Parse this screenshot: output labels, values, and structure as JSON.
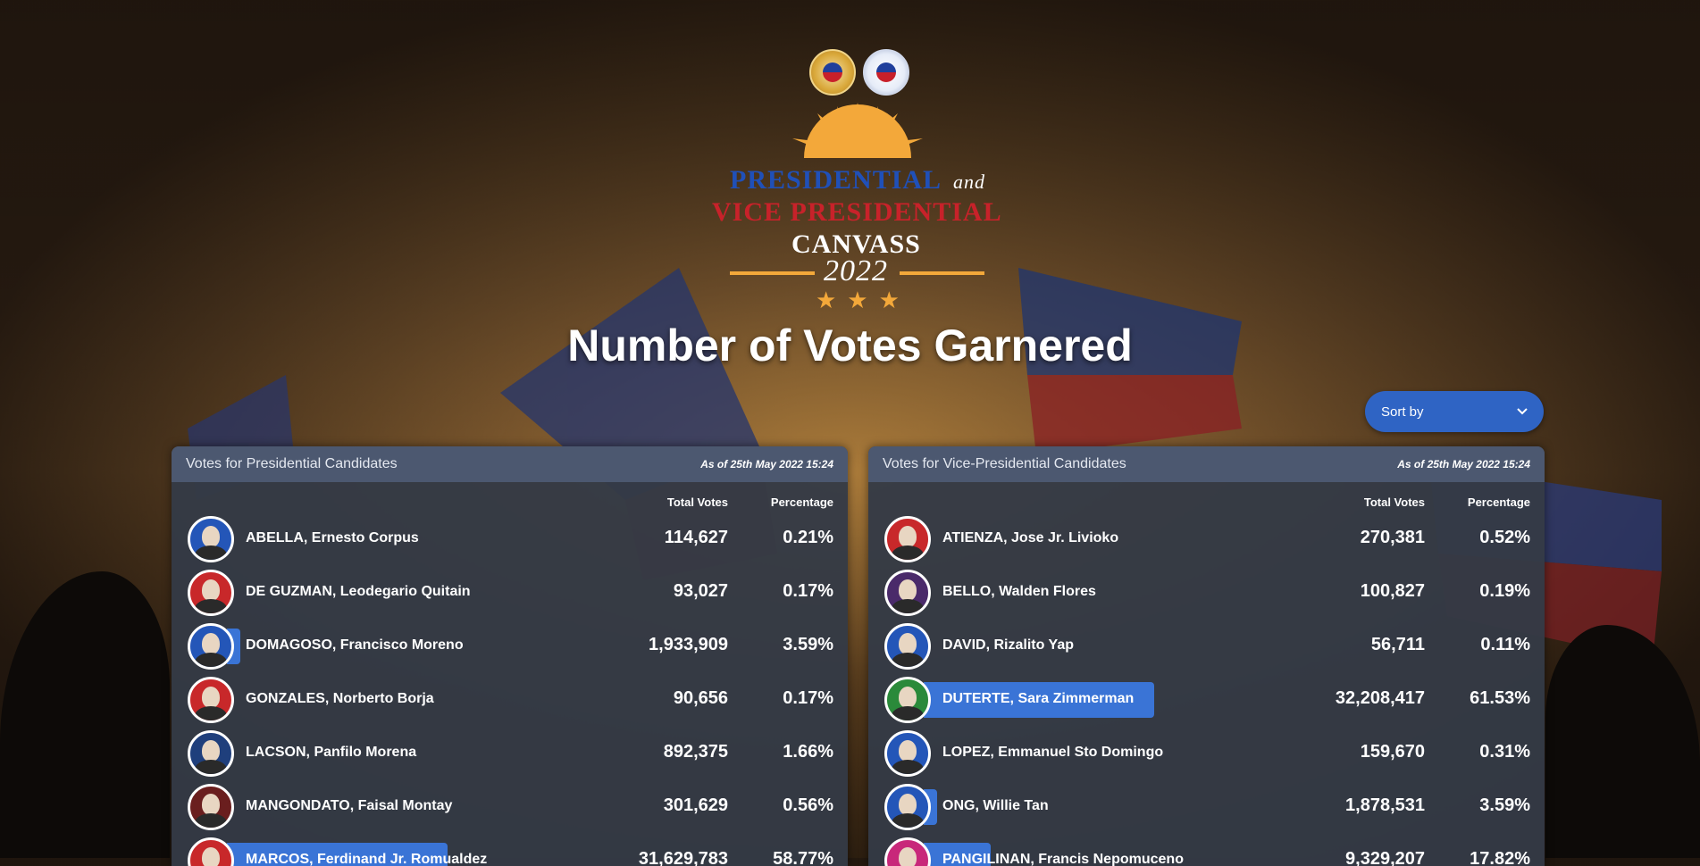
{
  "logo": {
    "word_presidential": "PRESIDENTIAL",
    "word_and": "and",
    "word_vice": "VICE PRESIDENTIAL",
    "word_canvass": "CANVASS",
    "year": "2022"
  },
  "title": "Number of Votes Garnered",
  "sort": {
    "label": "Sort by"
  },
  "colors": {
    "accent": "#3a74d6",
    "panel": "#343a46",
    "panel_head": "#4c5870",
    "sort_bg": "#2f64c4"
  },
  "presidential": {
    "header": "Votes for Presidential Candidates",
    "as_of": "As of 25th May 2022 15:24",
    "col_total": "Total Votes",
    "col_pct": "Percentage",
    "rows": [
      {
        "name": "ABELLA, Ernesto Corpus",
        "votes": "114,627",
        "pct": "0.21%",
        "ring": "#2456b8",
        "bar": 0
      },
      {
        "name": "DE GUZMAN, Leodegario Quitain",
        "votes": "93,027",
        "pct": "0.17%",
        "ring": "#c8282a",
        "bar": 0
      },
      {
        "name": "DOMAGOSO, Francisco Moreno",
        "votes": "1,933,909",
        "pct": "3.59%",
        "ring": "#2456b8",
        "bar": 3.59
      },
      {
        "name": "GONZALES, Norberto Borja",
        "votes": "90,656",
        "pct": "0.17%",
        "ring": "#c8282a",
        "bar": 0
      },
      {
        "name": "LACSON, Panfilo Morena",
        "votes": "892,375",
        "pct": "1.66%",
        "ring": "#1f3f7c",
        "bar": 0
      },
      {
        "name": "MANGONDATO, Faisal Montay",
        "votes": "301,629",
        "pct": "0.56%",
        "ring": "#6a1e1e",
        "bar": 0
      },
      {
        "name": "MARCOS, Ferdinand Jr. Romualdez",
        "votes": "31,629,783",
        "pct": "58.77%",
        "ring": "#c8282a",
        "bar": 58.77
      }
    ]
  },
  "vice": {
    "header": "Votes for Vice-Presidential Candidates",
    "as_of": "As of 25th May 2022 15:24",
    "col_total": "Total Votes",
    "col_pct": "Percentage",
    "rows": [
      {
        "name": "ATIENZA, Jose Jr. Livioko",
        "votes": "270,381",
        "pct": "0.52%",
        "ring": "#c8282a",
        "bar": 0
      },
      {
        "name": "BELLO, Walden Flores",
        "votes": "100,827",
        "pct": "0.19%",
        "ring": "#4a2a6a",
        "bar": 0
      },
      {
        "name": "DAVID, Rizalito Yap",
        "votes": "56,711",
        "pct": "0.11%",
        "ring": "#2456b8",
        "bar": 0
      },
      {
        "name": "DUTERTE, Sara Zimmerman",
        "votes": "32,208,417",
        "pct": "61.53%",
        "ring": "#2a8a3a",
        "bar": 61.53
      },
      {
        "name": "LOPEZ, Emmanuel Sto Domingo",
        "votes": "159,670",
        "pct": "0.31%",
        "ring": "#2456b8",
        "bar": 0
      },
      {
        "name": "ONG, Willie Tan",
        "votes": "1,878,531",
        "pct": "3.59%",
        "ring": "#2456b8",
        "bar": 3.59
      },
      {
        "name": "PANGILINAN, Francis Nepomuceno",
        "votes": "9,329,207",
        "pct": "17.82%",
        "ring": "#c8287a",
        "bar": 17.82
      }
    ]
  }
}
